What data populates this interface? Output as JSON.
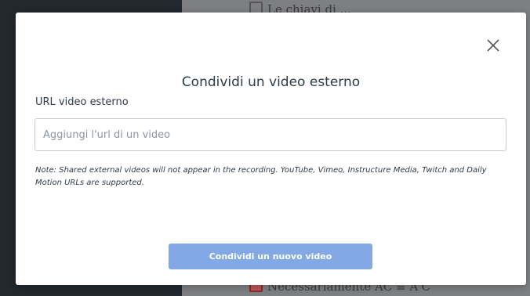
{
  "background": {
    "top_text": "Le chiavi di ...",
    "bottom_text": "Necessariamente AC ≡ A'C'"
  },
  "modal": {
    "title": "Condividi un video esterno",
    "url_label": "URL video esterno",
    "url_value": "",
    "url_placeholder": "Aggiungi l'url di un video",
    "note": "Note: Shared external videos will not appear in the recording. YouTube, Vimeo, Instructure Media, Twitch and Daily Motion URLs are supported.",
    "submit_label": "Condividi un nuovo video",
    "close_icon": "close-icon"
  },
  "colors": {
    "sidebar": "#22282e",
    "overlay": "#7d7f82",
    "button": "#82a9e6",
    "text": "#2d3b45"
  }
}
